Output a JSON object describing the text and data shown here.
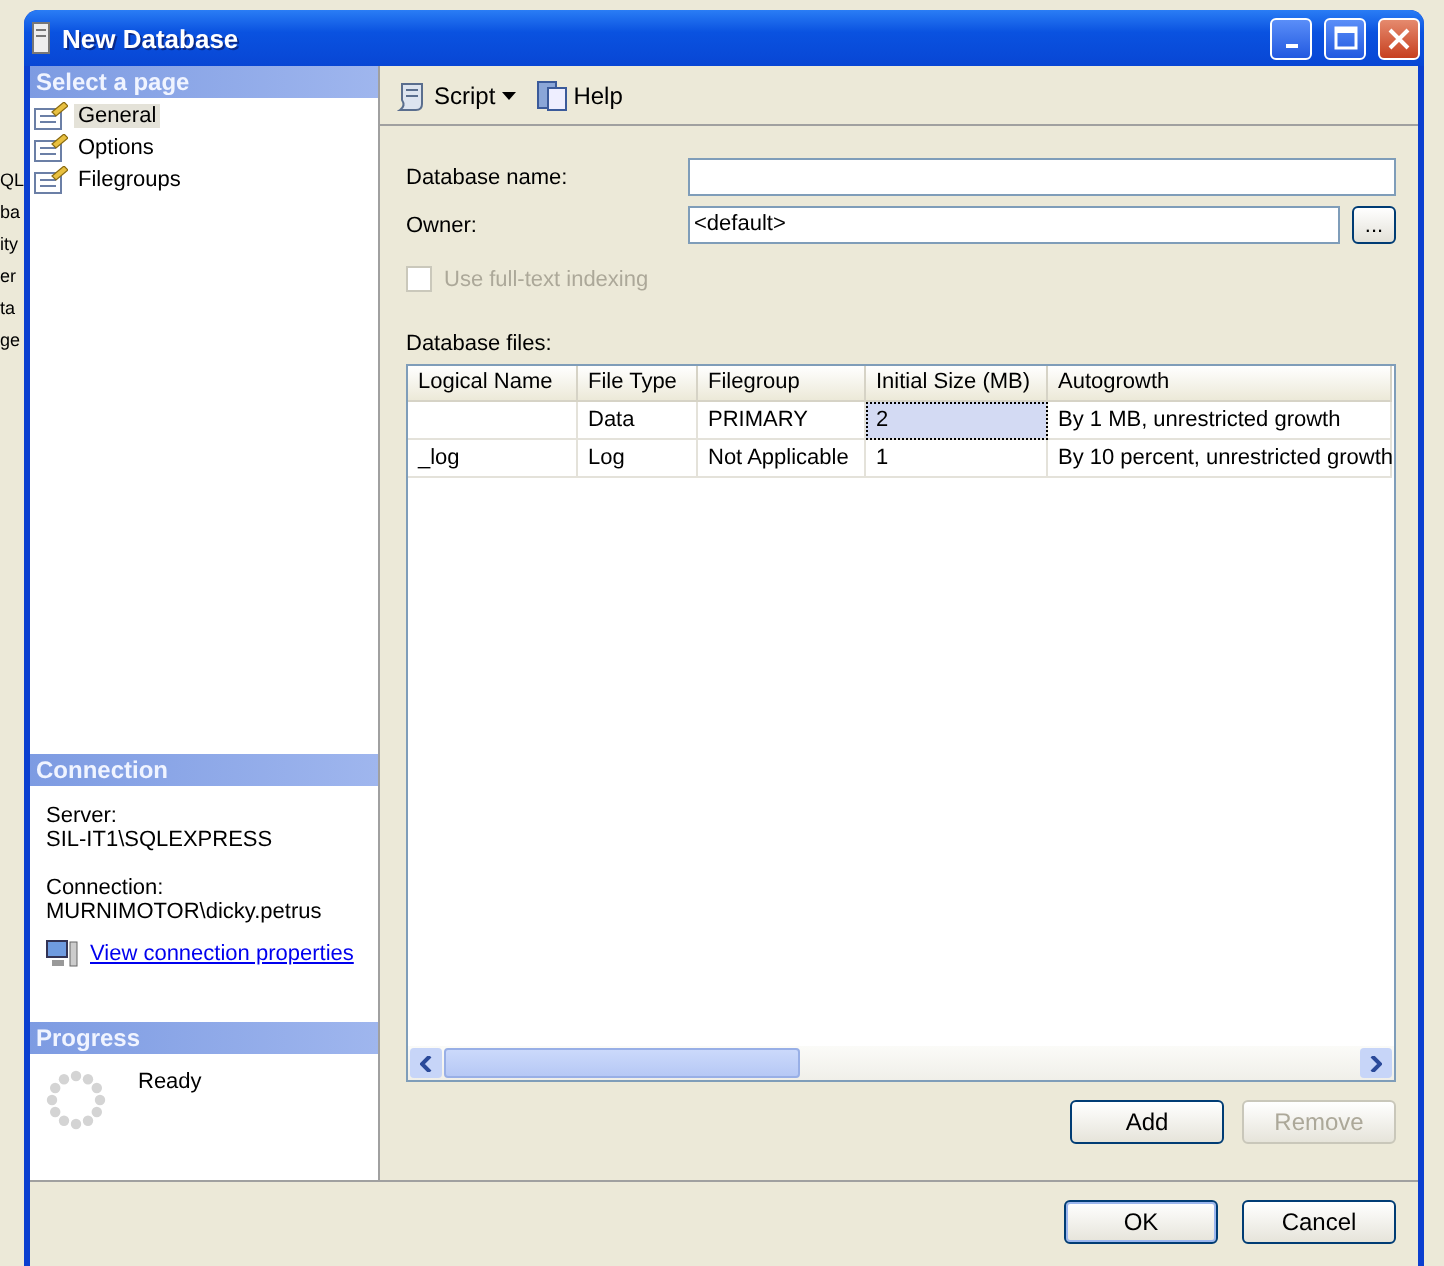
{
  "background_app": {
    "side_fragments": [
      "QL",
      "ba",
      "ity",
      "er",
      "ta",
      "ge"
    ]
  },
  "window": {
    "title": "New Database"
  },
  "sidebar": {
    "select_header": "Select a page",
    "pages": [
      {
        "label": "General",
        "selected": true
      },
      {
        "label": "Options",
        "selected": false
      },
      {
        "label": "Filegroups",
        "selected": false
      }
    ],
    "connection_header": "Connection",
    "server_label": "Server:",
    "server": "SIL-IT1\\SQLEXPRESS",
    "connection_label": "Connection:",
    "connection": "MURNIMOTOR\\dicky.petrus",
    "connection_link": "View connection properties",
    "progress_header": "Progress",
    "progress_status": "Ready"
  },
  "toolbar": {
    "script": "Script",
    "help": "Help"
  },
  "form": {
    "name_label": "Database name:",
    "owner_label": "Owner:",
    "owner_value": "<default>",
    "browse": "...",
    "fulltext": {
      "label": "Use full-text indexing",
      "checked": false,
      "disabled": true
    }
  },
  "files": {
    "label": "Database files:",
    "columns": [
      "Logical Name",
      "File Type",
      "Filegroup",
      "Initial Size (MB)",
      "Autogrowth"
    ],
    "rows": [
      {
        "cells": [
          {
            "selected": false
          },
          {
            "text": "Data",
            "selected": false
          },
          {
            "text": "PRIMARY",
            "selected": false
          },
          {
            "text": "2",
            "selected": true
          },
          {
            "text": "By 1 MB, unrestricted growth",
            "selected": false
          }
        ]
      },
      {
        "cells": [
          {
            "text": "_log",
            "selected": false
          },
          {
            "text": "Log",
            "selected": false
          },
          {
            "text": "Not Applicable",
            "selected": false
          },
          {
            "text": "1",
            "selected": false
          },
          {
            "text": "By 10 percent, unrestricted growth",
            "selected": false
          }
        ]
      }
    ],
    "add": {
      "label": "Add",
      "disabled": false
    },
    "remove": {
      "label": "Remove",
      "disabled": true
    }
  },
  "buttons": [
    {
      "label": "OK",
      "default": true
    },
    {
      "label": "Cancel",
      "default": false
    }
  ]
}
